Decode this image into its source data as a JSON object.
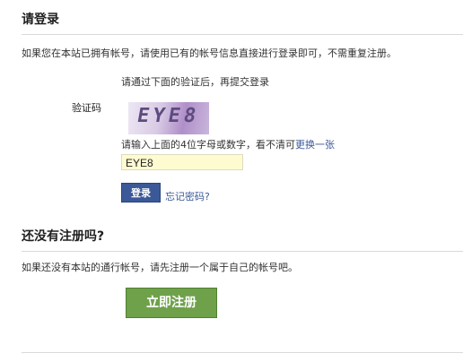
{
  "login": {
    "title": "请登录",
    "intro": "如果您在本站已拥有帐号，请使用已有的帐号信息直接进行登录即可，不需重复注册。",
    "verify_prompt": "请通过下面的验证后，再提交登录",
    "captcha_label": "验证码",
    "captcha_image_text": "EYE8",
    "captcha_hint": "请输入上面的4位字母或数字，看不清可",
    "captcha_refresh_link": "更换一张",
    "captcha_input_value": "EYE8",
    "submit_label": "登录",
    "forgot_password_link": "忘记密码?"
  },
  "register": {
    "title": "还没有注册吗?",
    "intro": "如果还没有本站的通行帐号，请先注册一个属于自己的帐号吧。",
    "button_label": "立即注册"
  },
  "colors": {
    "link": "#3b5998",
    "login_button": "#3b5998",
    "register_button": "#6fa14b",
    "input_background": "#fffbd0"
  }
}
